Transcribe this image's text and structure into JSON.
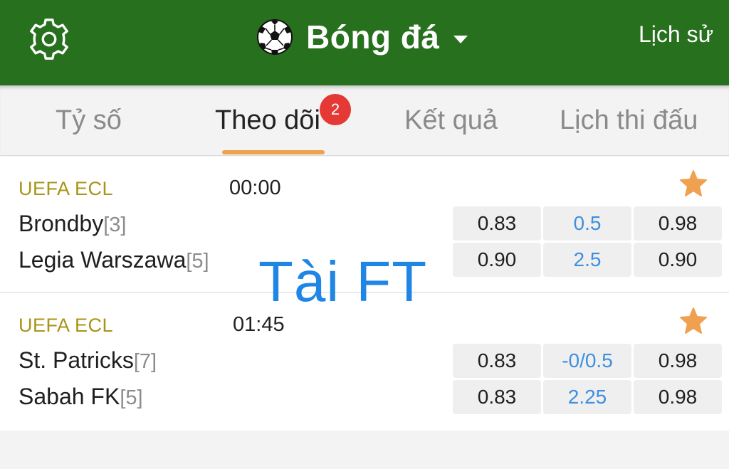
{
  "header": {
    "title": "Bóng đá",
    "history_label": "Lịch sử",
    "icons": [
      "gear-icon",
      "soccer-ball-icon",
      "caret-down-icon"
    ],
    "color": "#27701d"
  },
  "tabs": [
    {
      "label": "Tỷ số"
    },
    {
      "label": "Theo dõi",
      "badge": "2"
    },
    {
      "label": "Kết quả"
    },
    {
      "label": "Lịch thi đấu"
    }
  ],
  "active_tab": "Theo dõi",
  "matches": [
    {
      "league": "UEFA ECL",
      "time": "00:00",
      "home": {
        "name": "Brondby",
        "rank": "[3]"
      },
      "away": {
        "name": "Legia Warszawa",
        "rank": "[5]"
      },
      "odds": [
        [
          "0.83",
          "0.5",
          "0.98"
        ],
        [
          "0.90",
          "2.5",
          "0.90"
        ]
      ]
    },
    {
      "league": "UEFA ECL",
      "time": "01:45",
      "home": {
        "name": "St. Patricks",
        "rank": "[7]"
      },
      "away": {
        "name": "Sabah FK",
        "rank": "[5]"
      },
      "odds": [
        [
          "0.83",
          "-0/0.5",
          "0.98"
        ],
        [
          "0.83",
          "2.25",
          "0.98"
        ]
      ]
    }
  ],
  "overlay_text": "Tài FT",
  "colors": {
    "accent": "#f0a150",
    "badge": "#e53935",
    "league": "#a89418",
    "handicap": "#3d8fe0"
  }
}
